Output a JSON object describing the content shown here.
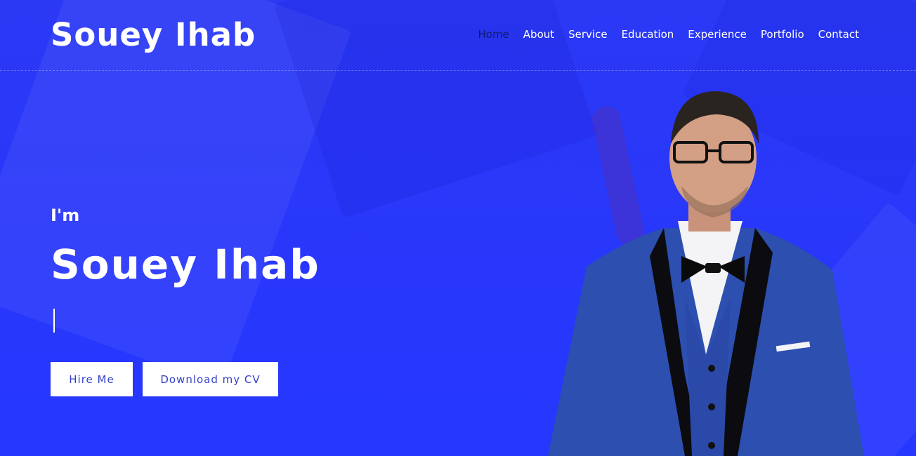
{
  "header": {
    "logo": "Souey Ihab",
    "nav": [
      {
        "label": "Home",
        "active": true
      },
      {
        "label": "About"
      },
      {
        "label": "Service"
      },
      {
        "label": "Education"
      },
      {
        "label": "Experience"
      },
      {
        "label": "Portfolio"
      },
      {
        "label": "Contact"
      }
    ]
  },
  "hero": {
    "greeting": "I'm",
    "name": "Souey Ihab",
    "buttons": {
      "hire": "Hire Me",
      "cv": "Download my CV"
    }
  },
  "colors": {
    "background": "#2a38f7",
    "active_nav": "#111a6b",
    "button_text": "#3341c9"
  }
}
